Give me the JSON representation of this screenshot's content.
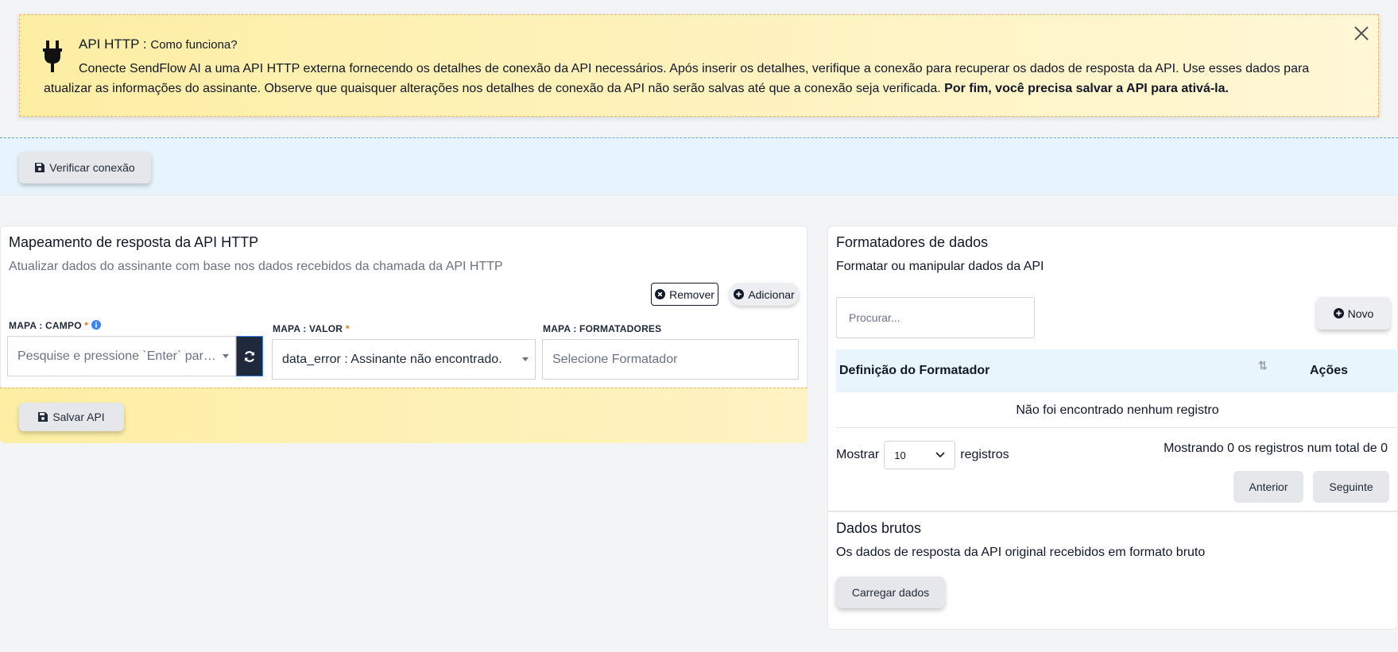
{
  "notice": {
    "title": "API HTTP : ",
    "subtitle": "Como funciona?",
    "body": "Conecte SendFlow AI a uma API HTTP externa fornecendo os detalhes de conexão da API necessários. Após inserir os detalhes, verifique a conexão para recuperar os dados de resposta da API. Use esses dados para atualizar as informações do assinante. Observe que quaisquer alterações nos detalhes de conexão da API não serão salvas até que a conexão seja verificada. ",
    "body_bold": "Por fim, você precisa salvar a API para ativá-la.",
    "icon": "plug-icon",
    "close_icon": "close-icon"
  },
  "verify": {
    "label": "Verificar conexão",
    "icon": "save-icon"
  },
  "mapping": {
    "title": "Mapeamento de resposta da API HTTP",
    "description": "Atualizar dados do assinante com base nos dados recebidos da chamada da API HTTP",
    "remove_label": "Remover",
    "add_label": "Adicionar",
    "field_label": "MAPA : CAMPO",
    "field_placeholder": "Pesquise e pressione `Enter` para...",
    "value_label": "MAPA : VALOR",
    "value_selected": "data_error : Assinante não encontrado.",
    "formatters_label": "MAPA : FORMATADORES",
    "formatters_placeholder": "Selecione Formatador",
    "required_mark": "*",
    "save_label": "Salvar API"
  },
  "formatters": {
    "title": "Formatadores de dados",
    "description": "Formatar ou manipular dados da API",
    "search_placeholder": "Procurar...",
    "new_label": "Novo",
    "columns": [
      "Definição do Formatador",
      "Ações"
    ],
    "empty_text": "Não foi encontrado nenhum registro",
    "show_label": "Mostrar",
    "page_length": "10",
    "records_label": "registros",
    "info": "Mostrando 0 os registros num total de 0",
    "prev_label": "Anterior",
    "next_label": "Seguinte"
  },
  "raw": {
    "title": "Dados brutos",
    "description": "Os dados de resposta da API original recebidos em formato bruto",
    "load_label": "Carregar dados"
  },
  "colors": {
    "notice_bg": "#fdeea4",
    "verify_bg": "#e7f4fd",
    "dark_button": "#1e2a3b",
    "required": "#f97316",
    "info_icon": "#3b82f6"
  }
}
